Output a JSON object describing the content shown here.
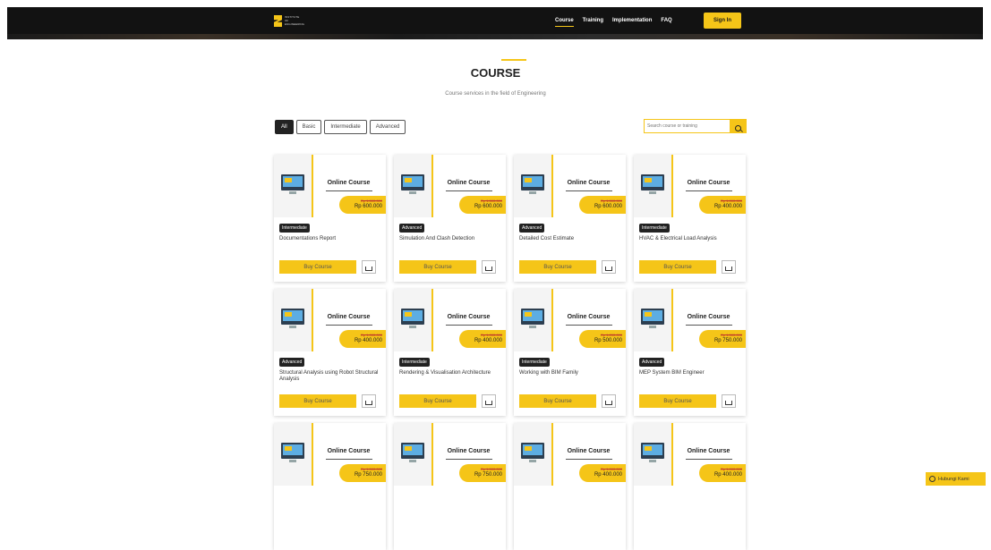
{
  "nav": {
    "logo_line1": "INSTITUTE",
    "logo_line2": "OF",
    "logo_line3": "ENGINEERING",
    "links": [
      {
        "label": "Course"
      },
      {
        "label": "Training"
      },
      {
        "label": "Implementation"
      },
      {
        "label": "FAQ"
      }
    ],
    "signin_label": "Sign In"
  },
  "hero": {
    "title": "COURSE",
    "subtitle": "Course services in the field of Engineering"
  },
  "filters": [
    {
      "label": "All",
      "active": true
    },
    {
      "label": "Basic"
    },
    {
      "label": "Intermediate"
    },
    {
      "label": "Advanced"
    }
  ],
  "search": {
    "placeholder": "Search course or training"
  },
  "courses": [
    {
      "thumb_title": "Online Course",
      "old_price": "Rp 1.500.000",
      "price": "Rp 600.000",
      "level": "Intermediate",
      "name": "Documentations Report",
      "buy_label": "Buy Course"
    },
    {
      "thumb_title": "Online Course",
      "old_price": "Rp 1.500.000",
      "price": "Rp 600.000",
      "level": "Advanced",
      "name": "Simulation And Clash Detection",
      "buy_label": "Buy Course"
    },
    {
      "thumb_title": "Online Course",
      "old_price": "Rp 1.500.000",
      "price": "Rp 600.000",
      "level": "Advanced",
      "name": "Detailed Cost Estimate",
      "buy_label": "Buy Course"
    },
    {
      "thumb_title": "Online Course",
      "old_price": "Rp 1.000.000",
      "price": "Rp 400.000",
      "level": "Intermediate",
      "name": "HVAC & Electrical Load Analysis",
      "buy_label": "Buy Course"
    },
    {
      "thumb_title": "Online Course",
      "old_price": "Rp 1.000.000",
      "price": "Rp 400.000",
      "level": "Advanced",
      "name": "Structural Analysis using Robot Structural Analysis",
      "buy_label": "Buy Course"
    },
    {
      "thumb_title": "Online Course",
      "old_price": "Rp 1.000.000",
      "price": "Rp 400.000",
      "level": "Intermediate",
      "name": "Rendering & Visualisation Architecture",
      "buy_label": "Buy Course"
    },
    {
      "thumb_title": "Online Course",
      "old_price": "Rp 1.200.000",
      "price": "Rp 500.000",
      "level": "Intermediate",
      "name": "Working with BIM Family",
      "buy_label": "Buy Course"
    },
    {
      "thumb_title": "Online Course",
      "old_price": "Rp 1.500.000",
      "price": "Rp 750.000",
      "level": "Advanced",
      "name": "MEP System BIM Engineer",
      "buy_label": "Buy Course"
    },
    {
      "thumb_title": "Online Course",
      "old_price": "Rp 1.500.000",
      "price": "Rp 750.000"
    },
    {
      "thumb_title": "Online Course",
      "old_price": "Rp 1.500.000",
      "price": "Rp 750.000"
    },
    {
      "thumb_title": "Online Course",
      "old_price": "Rp 1.000.000",
      "price": "Rp 400.000"
    },
    {
      "thumb_title": "Online Course",
      "old_price": "Rp 1.000.000",
      "price": "Rp 400.000"
    }
  ],
  "contact_label": "Hubungi Kami",
  "colors": {
    "accent": "#f5c518",
    "dark": "#121212"
  },
  "icons": [
    "search-icon",
    "cart-icon",
    "whatsapp-icon",
    "monitor-icon"
  ]
}
